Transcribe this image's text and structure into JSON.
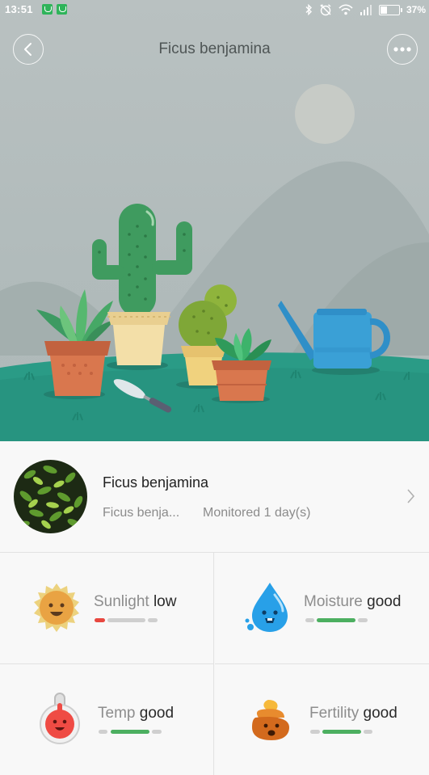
{
  "status_bar": {
    "time": "13:51",
    "battery_percent": "37%",
    "battery_level": 0.37,
    "icons": [
      "notification-icon",
      "notification-icon",
      "bluetooth-icon",
      "alarm-off-icon",
      "wifi-icon",
      "signal-icon",
      "battery-icon"
    ]
  },
  "header": {
    "title": "Ficus benjamina",
    "back_icon": "chevron-left-icon",
    "more_icon": "more-dots-icon"
  },
  "plant": {
    "name": "Ficus benjamina",
    "latin": "Ficus benja...",
    "monitored": "Monitored 1 day(s)"
  },
  "metrics": {
    "sunlight": {
      "label": "Sunlight",
      "status": "low",
      "level_color": "#e8473f",
      "icon": "sun-face-icon"
    },
    "moisture": {
      "label": "Moisture",
      "status": "good",
      "level_color": "#4caf60",
      "icon": "water-drop-face-icon"
    },
    "temp": {
      "label": "Temp",
      "status": "good",
      "level_color": "#4caf60",
      "icon": "thermometer-face-icon"
    },
    "fertility": {
      "label": "Fertility",
      "status": "good",
      "level_color": "#4caf60",
      "icon": "fertilizer-face-icon"
    }
  },
  "colors": {
    "sky": "#b9c1c1",
    "ground": "#2a9b86",
    "low": "#e8473f",
    "good": "#4caf60",
    "bar_track": "#cfcfcf"
  }
}
